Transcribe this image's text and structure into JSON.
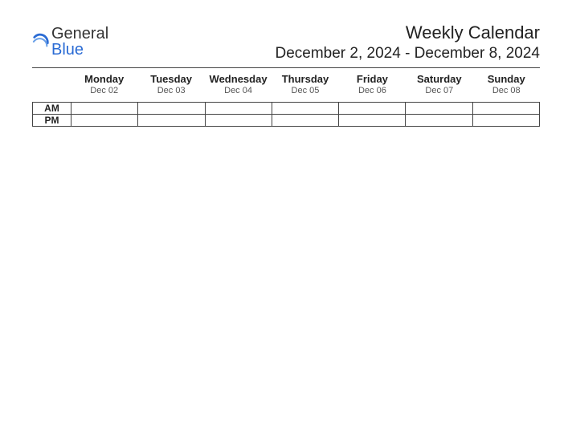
{
  "logo": {
    "text1": "General",
    "text2": "Blue"
  },
  "header": {
    "title": "Weekly Calendar",
    "date_range": "December 2, 2024 - December 8, 2024"
  },
  "row_labels": [
    "AM",
    "PM"
  ],
  "days": [
    {
      "name": "Monday",
      "date": "Dec 02"
    },
    {
      "name": "Tuesday",
      "date": "Dec 03"
    },
    {
      "name": "Wednesday",
      "date": "Dec 04"
    },
    {
      "name": "Thursday",
      "date": "Dec 05"
    },
    {
      "name": "Friday",
      "date": "Dec 06"
    },
    {
      "name": "Saturday",
      "date": "Dec 07"
    },
    {
      "name": "Sunday",
      "date": "Dec 08"
    }
  ]
}
